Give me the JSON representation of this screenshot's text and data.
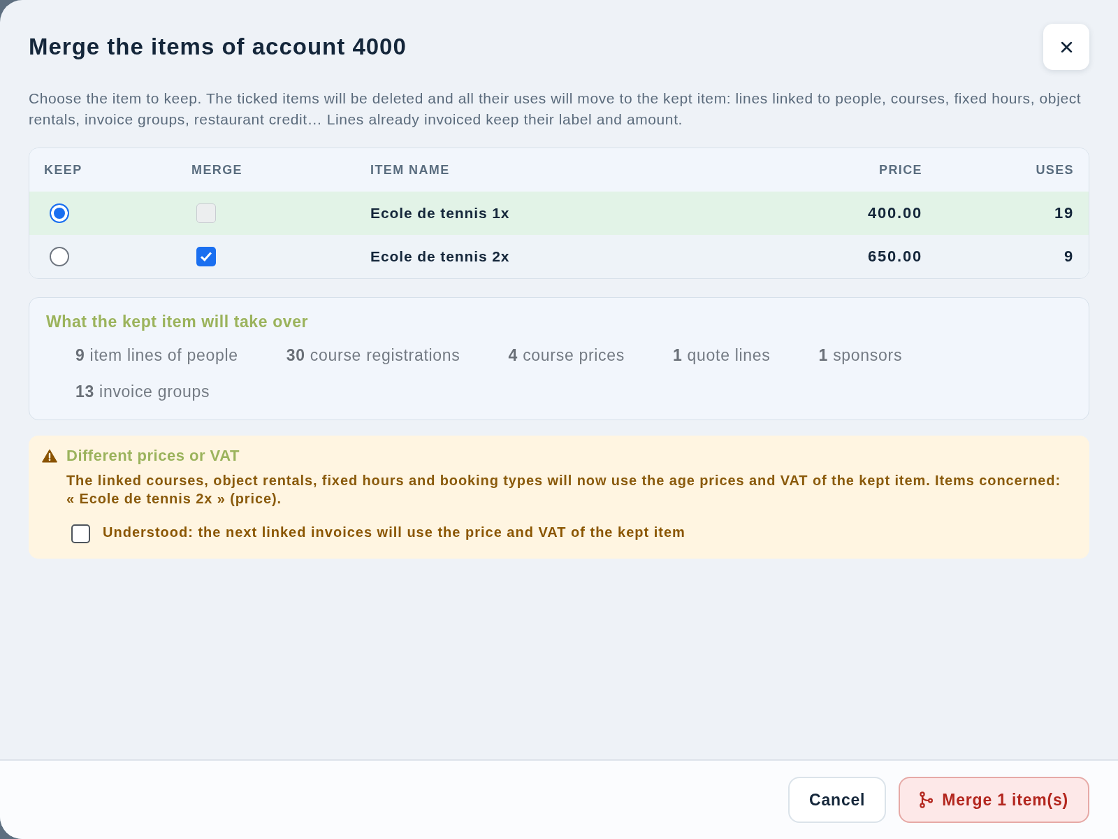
{
  "dialog": {
    "title": "Merge the items of account 4000",
    "description": "Choose the item to keep. The ticked items will be deleted and all their uses will move to the kept item: lines linked to people, courses, fixed hours, object rentals, invoice groups, restaurant credit… Lines already invoiced keep their label and amount."
  },
  "table": {
    "columns": [
      {
        "label": "KEEP",
        "kind": "keep"
      },
      {
        "label": "MERGE",
        "kind": "merge"
      },
      {
        "label": "ITEM NAME",
        "kind": "name"
      },
      {
        "label": "PRICE",
        "kind": "price"
      },
      {
        "label": "USES",
        "kind": "uses"
      }
    ],
    "rows": [
      {
        "selected": true,
        "merge": {
          "checked": false,
          "disabled": true
        },
        "name": "Ecole de tennis 1x",
        "price": "400.00",
        "uses": "19"
      },
      {
        "selected": false,
        "merge": {
          "checked": true,
          "disabled": false
        },
        "name": "Ecole de tennis 2x",
        "price": "650.00",
        "uses": "9"
      }
    ]
  },
  "summary": {
    "title": "What the kept item will take over",
    "stats": [
      {
        "count": "9",
        "label": "item lines of people"
      },
      {
        "count": "30",
        "label": "course registrations"
      },
      {
        "count": "4",
        "label": "course prices"
      },
      {
        "count": "1",
        "label": "quote lines"
      },
      {
        "count": "1",
        "label": "sponsors"
      },
      {
        "count": "13",
        "label": "invoice groups"
      }
    ]
  },
  "warning": {
    "title": "Different prices or VAT",
    "text": "The linked courses, object rentals, fixed hours and booking types will now use the age prices and VAT of the kept item. Items concerned: « Ecole de tennis 2x » (price).",
    "confirm": {
      "label": "Understood: the next linked invoices will use the price and VAT of the kept item",
      "checked": false
    }
  },
  "footer": {
    "buttons": [
      {
        "label": "Cancel",
        "kind": "secondary"
      },
      {
        "label": "Merge 1 item(s)",
        "kind": "danger"
      }
    ]
  }
}
